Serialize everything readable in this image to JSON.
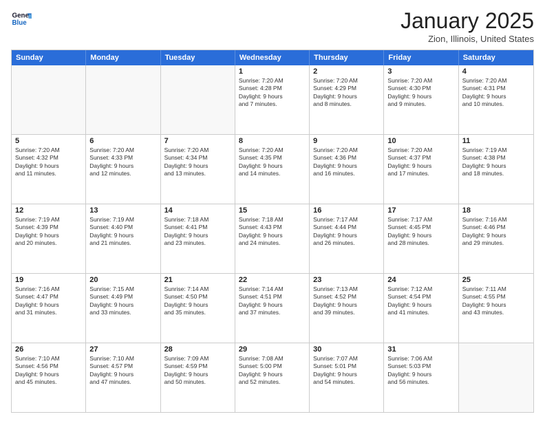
{
  "header": {
    "logo_line1": "General",
    "logo_line2": "Blue",
    "month_title": "January 2025",
    "location": "Zion, Illinois, United States"
  },
  "days_of_week": [
    "Sunday",
    "Monday",
    "Tuesday",
    "Wednesday",
    "Thursday",
    "Friday",
    "Saturday"
  ],
  "weeks": [
    [
      {
        "day": "",
        "info": ""
      },
      {
        "day": "",
        "info": ""
      },
      {
        "day": "",
        "info": ""
      },
      {
        "day": "1",
        "info": "Sunrise: 7:20 AM\nSunset: 4:28 PM\nDaylight: 9 hours\nand 7 minutes."
      },
      {
        "day": "2",
        "info": "Sunrise: 7:20 AM\nSunset: 4:29 PM\nDaylight: 9 hours\nand 8 minutes."
      },
      {
        "day": "3",
        "info": "Sunrise: 7:20 AM\nSunset: 4:30 PM\nDaylight: 9 hours\nand 9 minutes."
      },
      {
        "day": "4",
        "info": "Sunrise: 7:20 AM\nSunset: 4:31 PM\nDaylight: 9 hours\nand 10 minutes."
      }
    ],
    [
      {
        "day": "5",
        "info": "Sunrise: 7:20 AM\nSunset: 4:32 PM\nDaylight: 9 hours\nand 11 minutes."
      },
      {
        "day": "6",
        "info": "Sunrise: 7:20 AM\nSunset: 4:33 PM\nDaylight: 9 hours\nand 12 minutes."
      },
      {
        "day": "7",
        "info": "Sunrise: 7:20 AM\nSunset: 4:34 PM\nDaylight: 9 hours\nand 13 minutes."
      },
      {
        "day": "8",
        "info": "Sunrise: 7:20 AM\nSunset: 4:35 PM\nDaylight: 9 hours\nand 14 minutes."
      },
      {
        "day": "9",
        "info": "Sunrise: 7:20 AM\nSunset: 4:36 PM\nDaylight: 9 hours\nand 16 minutes."
      },
      {
        "day": "10",
        "info": "Sunrise: 7:20 AM\nSunset: 4:37 PM\nDaylight: 9 hours\nand 17 minutes."
      },
      {
        "day": "11",
        "info": "Sunrise: 7:19 AM\nSunset: 4:38 PM\nDaylight: 9 hours\nand 18 minutes."
      }
    ],
    [
      {
        "day": "12",
        "info": "Sunrise: 7:19 AM\nSunset: 4:39 PM\nDaylight: 9 hours\nand 20 minutes."
      },
      {
        "day": "13",
        "info": "Sunrise: 7:19 AM\nSunset: 4:40 PM\nDaylight: 9 hours\nand 21 minutes."
      },
      {
        "day": "14",
        "info": "Sunrise: 7:18 AM\nSunset: 4:41 PM\nDaylight: 9 hours\nand 23 minutes."
      },
      {
        "day": "15",
        "info": "Sunrise: 7:18 AM\nSunset: 4:43 PM\nDaylight: 9 hours\nand 24 minutes."
      },
      {
        "day": "16",
        "info": "Sunrise: 7:17 AM\nSunset: 4:44 PM\nDaylight: 9 hours\nand 26 minutes."
      },
      {
        "day": "17",
        "info": "Sunrise: 7:17 AM\nSunset: 4:45 PM\nDaylight: 9 hours\nand 28 minutes."
      },
      {
        "day": "18",
        "info": "Sunrise: 7:16 AM\nSunset: 4:46 PM\nDaylight: 9 hours\nand 29 minutes."
      }
    ],
    [
      {
        "day": "19",
        "info": "Sunrise: 7:16 AM\nSunset: 4:47 PM\nDaylight: 9 hours\nand 31 minutes."
      },
      {
        "day": "20",
        "info": "Sunrise: 7:15 AM\nSunset: 4:49 PM\nDaylight: 9 hours\nand 33 minutes."
      },
      {
        "day": "21",
        "info": "Sunrise: 7:14 AM\nSunset: 4:50 PM\nDaylight: 9 hours\nand 35 minutes."
      },
      {
        "day": "22",
        "info": "Sunrise: 7:14 AM\nSunset: 4:51 PM\nDaylight: 9 hours\nand 37 minutes."
      },
      {
        "day": "23",
        "info": "Sunrise: 7:13 AM\nSunset: 4:52 PM\nDaylight: 9 hours\nand 39 minutes."
      },
      {
        "day": "24",
        "info": "Sunrise: 7:12 AM\nSunset: 4:54 PM\nDaylight: 9 hours\nand 41 minutes."
      },
      {
        "day": "25",
        "info": "Sunrise: 7:11 AM\nSunset: 4:55 PM\nDaylight: 9 hours\nand 43 minutes."
      }
    ],
    [
      {
        "day": "26",
        "info": "Sunrise: 7:10 AM\nSunset: 4:56 PM\nDaylight: 9 hours\nand 45 minutes."
      },
      {
        "day": "27",
        "info": "Sunrise: 7:10 AM\nSunset: 4:57 PM\nDaylight: 9 hours\nand 47 minutes."
      },
      {
        "day": "28",
        "info": "Sunrise: 7:09 AM\nSunset: 4:59 PM\nDaylight: 9 hours\nand 50 minutes."
      },
      {
        "day": "29",
        "info": "Sunrise: 7:08 AM\nSunset: 5:00 PM\nDaylight: 9 hours\nand 52 minutes."
      },
      {
        "day": "30",
        "info": "Sunrise: 7:07 AM\nSunset: 5:01 PM\nDaylight: 9 hours\nand 54 minutes."
      },
      {
        "day": "31",
        "info": "Sunrise: 7:06 AM\nSunset: 5:03 PM\nDaylight: 9 hours\nand 56 minutes."
      },
      {
        "day": "",
        "info": ""
      }
    ]
  ]
}
